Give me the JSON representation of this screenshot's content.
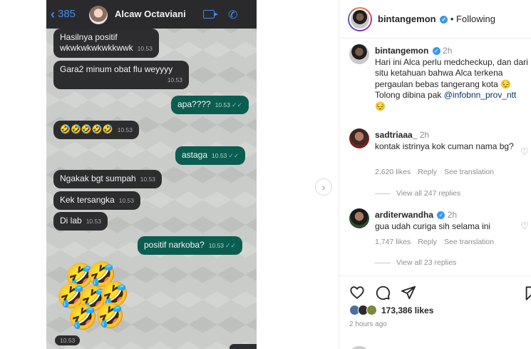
{
  "chat": {
    "back_count": "385",
    "contact_name": "Alcaw Octaviani",
    "messages": [
      {
        "dir": "in",
        "line1": "Hasilnya positif",
        "line2": "wkwkwkwkwkkwwk",
        "time": "10.53"
      },
      {
        "dir": "in",
        "line1": "Gara2 minum obat flu weyyyy",
        "time": "10.53"
      },
      {
        "dir": "out",
        "text": "apa????",
        "time": "10.53"
      },
      {
        "dir": "in",
        "text": "🤣🤣🤣🤣🤣",
        "time": "10.53"
      },
      {
        "dir": "out",
        "text": "astaga",
        "time": "10.53"
      },
      {
        "dir": "in",
        "text": "Ngakak bgt sumpah",
        "time": "10.53"
      },
      {
        "dir": "in",
        "text": "Kek tersangka",
        "time": "10.53"
      },
      {
        "dir": "in",
        "text": "Di lab",
        "time": "10.53"
      },
      {
        "dir": "out",
        "text": "positif narkoba?",
        "time": "10.53"
      }
    ],
    "big_emoji": "🤣",
    "last_time": "10.53"
  },
  "post": {
    "username": "bintangemon",
    "follow_status": "• Following",
    "caption": {
      "username": "bintangemon",
      "age": "2h",
      "text": "Hari ini Alca perlu medcheckup, dan dari situ ketahuan bahwa Alca terkena pergaulan bebas tangerang kota 😔 Tolong dibina pak ",
      "mention": "@infobnn_prov_ntt",
      "trailing_emoji": "😔"
    },
    "comments": [
      {
        "username": "sadtriaaa_",
        "age": "2h",
        "text": "kontak istrinya kok cuman nama bg?",
        "likes": "2,620 likes",
        "reply": "Reply",
        "translate": "See translation",
        "view_replies": "View all 247 replies"
      },
      {
        "username": "arditerwandha",
        "age": "2h",
        "text": "gua udah curiga sih selama ini",
        "likes": "1,747 likes",
        "reply": "Reply",
        "translate": "See translation",
        "view_replies": "View all 23 replies"
      }
    ],
    "likes_count": "173,386 likes",
    "posted_ago": "2 hours ago"
  },
  "icons": [
    "back-chevron-icon",
    "video-call-icon",
    "phone-icon",
    "next-arrow-icon",
    "verified-badge-icon",
    "heart-icon",
    "comment-icon",
    "share-icon",
    "bookmark-icon"
  ],
  "colors": {
    "chat_out": "#0b5e4f",
    "chat_in": "#2d2d2f",
    "ios_blue": "#3d8bf2",
    "ig_link": "#00376b",
    "verified": "#3897f0"
  }
}
